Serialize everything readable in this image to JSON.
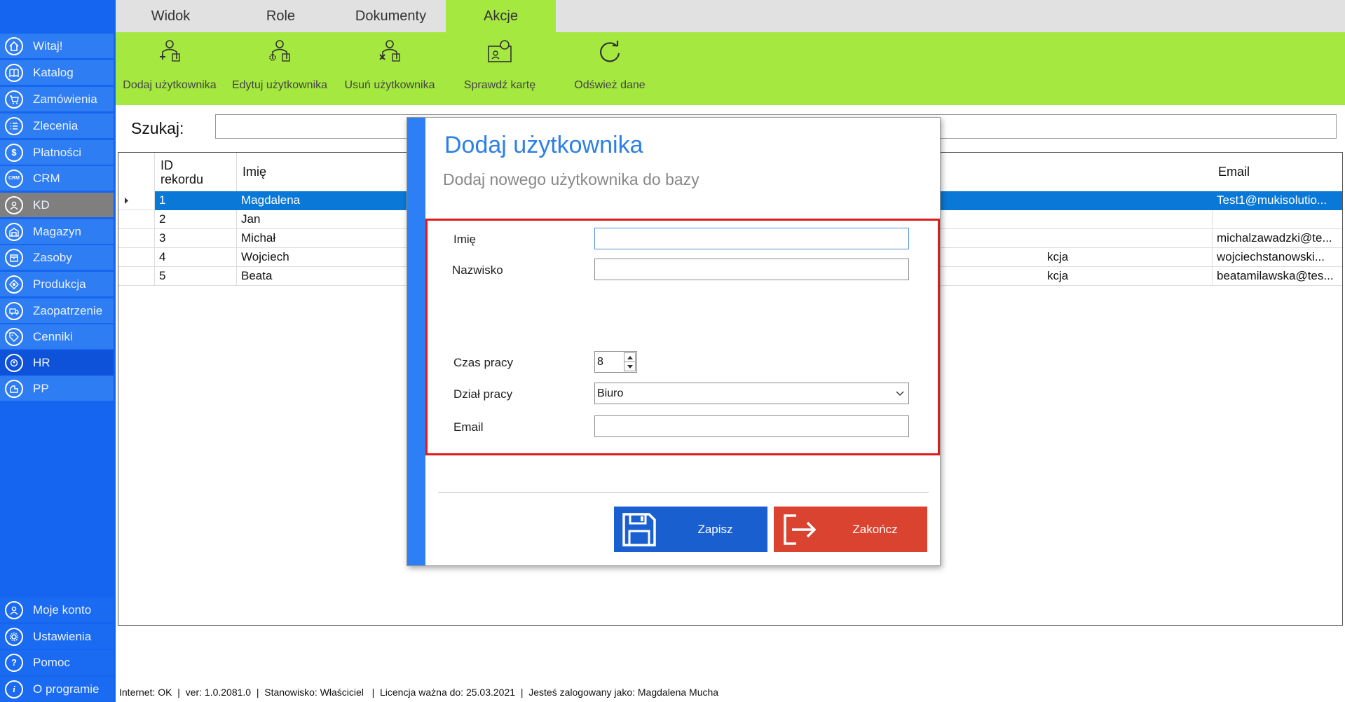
{
  "sidebar": {
    "items": [
      {
        "label": "Witaj!",
        "icon": "home-icon"
      },
      {
        "label": "Katalog",
        "icon": "book-icon"
      },
      {
        "label": "Zamówienia",
        "icon": "cart-icon"
      },
      {
        "label": "Zlecenia",
        "icon": "list-icon"
      },
      {
        "label": "Płatności",
        "icon": "dollar-icon",
        "glyph": "$"
      },
      {
        "label": "CRM",
        "icon": "crm-icon",
        "glyph": "CRM"
      },
      {
        "label": "KD",
        "icon": "user-icon"
      },
      {
        "label": "Magazyn",
        "icon": "warehouse-icon"
      },
      {
        "label": "Zasoby",
        "icon": "box-icon"
      },
      {
        "label": "Produkcja",
        "icon": "factory-icon"
      },
      {
        "label": "Zaopatrzenie",
        "icon": "truck-icon"
      },
      {
        "label": "Cenniki",
        "icon": "tag-icon"
      },
      {
        "label": "HR",
        "icon": "hr-icon"
      },
      {
        "label": "PP",
        "icon": "pp-icon"
      }
    ],
    "bottom": [
      {
        "label": "Moje konto",
        "icon": "account-icon"
      },
      {
        "label": "Ustawienia",
        "icon": "gear-icon"
      },
      {
        "label": "Pomoc",
        "icon": "help-icon",
        "glyph": "?"
      },
      {
        "label": "O programie",
        "icon": "info-icon",
        "glyph": "i"
      }
    ]
  },
  "tabs": [
    {
      "label": "Widok"
    },
    {
      "label": "Role"
    },
    {
      "label": "Dokumenty"
    },
    {
      "label": "Akcje"
    }
  ],
  "ribbon": {
    "add_user": "Dodaj użytkownika",
    "edit_user": "Edytuj użytkownika",
    "delete_user": "Usuń użytkownika",
    "check_card": "Sprawdź kartę",
    "refresh": "Odśwież dane"
  },
  "search": {
    "label": "Szukaj:",
    "value": ""
  },
  "grid": {
    "columns": {
      "id": "ID rekordu",
      "first_name": "Imię",
      "email": "Email"
    },
    "rows": [
      {
        "id": "1",
        "first_name": "Magdalena",
        "dept": "",
        "email": "Test1@mukisolutio..."
      },
      {
        "id": "2",
        "first_name": "Jan",
        "dept": "",
        "email": ""
      },
      {
        "id": "3",
        "first_name": "Michał",
        "dept": "",
        "email": "michalzawadzki@te..."
      },
      {
        "id": "4",
        "first_name": "Wojciech",
        "dept": "kcja",
        "email": "wojciechstanowski..."
      },
      {
        "id": "5",
        "first_name": "Beata",
        "dept": "kcja",
        "email": "beatamilawska@tes..."
      }
    ]
  },
  "status": {
    "internet": "Internet: OK",
    "version": "ver: 1.0.2081.0",
    "role": "Stanowisko: Właściciel",
    "license": "Licencja ważna do: 25.03.2021",
    "user": "Jesteś zalogowany jako: Magdalena Mucha"
  },
  "dialog": {
    "title": "Dodaj użytkownika",
    "subtitle": "Dodaj nowego użytkownika do bazy",
    "fields": {
      "first_name_label": "Imię",
      "first_name_value": "",
      "last_name_label": "Nazwisko",
      "last_name_value": "",
      "hours_label": "Czas pracy",
      "hours_value": "8",
      "dept_label": "Dział pracy",
      "dept_value": "Biuro",
      "email_label": "Email",
      "email_value": ""
    },
    "save_label": "Zapisz",
    "close_label": "Zakończ"
  },
  "colors": {
    "sidebar": "#1565f0",
    "ribbon": "#a5e83f",
    "selection": "#0a78d7",
    "dialog_accent": "#2d7ff5",
    "highlight_border": "#e01919",
    "save_button": "#1a5fd0",
    "close_button": "#d9432f"
  }
}
